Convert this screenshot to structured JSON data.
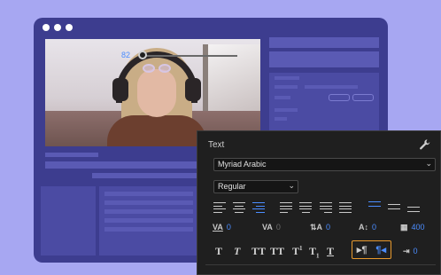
{
  "panel": {
    "title": "Text",
    "font_family": "Myriad Arabic",
    "font_style": "Regular",
    "font_size": "82",
    "font_size_slider_fraction": 0.0,
    "metrics": {
      "kerning": "0",
      "tracking": "0",
      "leading": "0",
      "baseline_shift": "0",
      "tsume": "400",
      "tab_width": "0"
    },
    "type_styles": [
      "T",
      "T",
      "TT",
      "TT",
      "T",
      "T",
      "T"
    ],
    "direction": {
      "ltr": "▸¶",
      "rtl": "¶◂"
    }
  },
  "icons": [
    "wrench-icon",
    "chevron-down-icon",
    "align-left-icon",
    "align-center-icon",
    "align-right-icon",
    "justify-left-icon",
    "justify-center-icon",
    "justify-right-icon",
    "justify-all-icon",
    "align-top-icon",
    "align-middle-icon",
    "align-bottom-icon"
  ],
  "colors": {
    "accent": "#4b8dff",
    "highlight": "#e89a2e",
    "background": "#a7a7f2",
    "window": "#3d3d8f"
  }
}
